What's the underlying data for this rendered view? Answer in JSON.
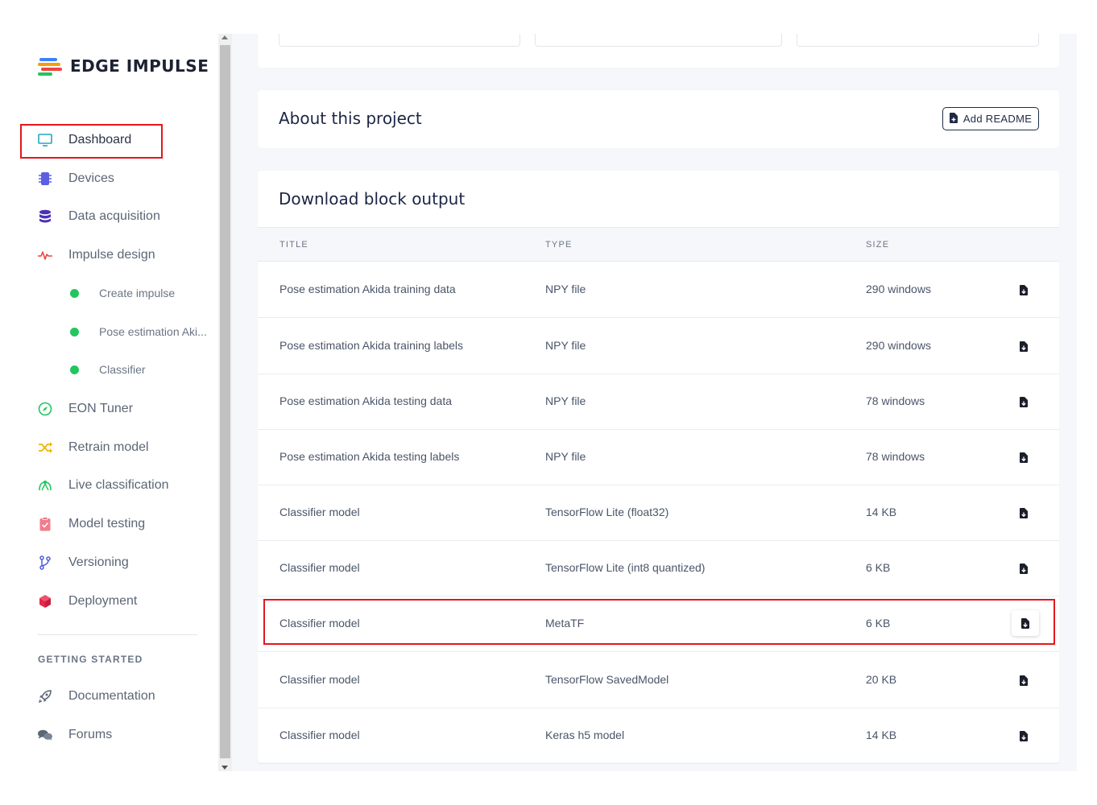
{
  "app": {
    "logo_text": "EDGE IMPULSE",
    "brand_colors": [
      "#3b82f6",
      "#f59e0b",
      "#ef4444",
      "#22c55e"
    ]
  },
  "sidebar": {
    "items": [
      {
        "label": "Dashboard",
        "icon": "monitor-icon",
        "color": "#22a7c5"
      },
      {
        "label": "Devices",
        "icon": "chip-icon",
        "color": "#5b5fe0"
      },
      {
        "label": "Data acquisition",
        "icon": "database-icon",
        "color": "#4c2fb5"
      },
      {
        "label": "Impulse design",
        "icon": "pulse-icon",
        "color": "#ef4444"
      },
      {
        "label": "EON Tuner",
        "icon": "compass-icon",
        "color": "#22c55e"
      },
      {
        "label": "Retrain model",
        "icon": "shuffle-icon",
        "color": "#f5b400"
      },
      {
        "label": "Live classification",
        "icon": "signal-icon",
        "color": "#22c55e"
      },
      {
        "label": "Model testing",
        "icon": "clipboard-check-icon",
        "color": "#f07c8c"
      },
      {
        "label": "Versioning",
        "icon": "branch-icon",
        "color": "#4f5fd6"
      },
      {
        "label": "Deployment",
        "icon": "cube-icon",
        "color": "#e5284b"
      }
    ],
    "sub_items": [
      {
        "label": "Create impulse"
      },
      {
        "label": "Pose estimation Aki..."
      },
      {
        "label": "Classifier"
      }
    ],
    "getting_started": {
      "heading": "GETTING STARTED",
      "items": [
        {
          "label": "Documentation",
          "icon": "rocket-icon"
        },
        {
          "label": "Forums",
          "icon": "chat-bubbles-icon"
        }
      ]
    }
  },
  "about": {
    "title": "About this project",
    "add_readme_label": "Add README"
  },
  "download": {
    "title": "Download block output",
    "columns": [
      "TITLE",
      "TYPE",
      "SIZE"
    ],
    "rows": [
      {
        "title": "Pose estimation Akida training data",
        "type": "NPY file",
        "size": "290 windows"
      },
      {
        "title": "Pose estimation Akida training labels",
        "type": "NPY file",
        "size": "290 windows"
      },
      {
        "title": "Pose estimation Akida testing data",
        "type": "NPY file",
        "size": "78 windows"
      },
      {
        "title": "Pose estimation Akida testing labels",
        "type": "NPY file",
        "size": "78 windows"
      },
      {
        "title": "Classifier model",
        "type": "TensorFlow Lite (float32)",
        "size": "14 KB"
      },
      {
        "title": "Classifier model",
        "type": "TensorFlow Lite (int8 quantized)",
        "size": "6 KB"
      },
      {
        "title": "Classifier model",
        "type": "MetaTF",
        "size": "6 KB"
      },
      {
        "title": "Classifier model",
        "type": "TensorFlow SavedModel",
        "size": "20 KB"
      },
      {
        "title": "Classifier model",
        "type": "Keras h5 model",
        "size": "14 KB"
      }
    ]
  }
}
